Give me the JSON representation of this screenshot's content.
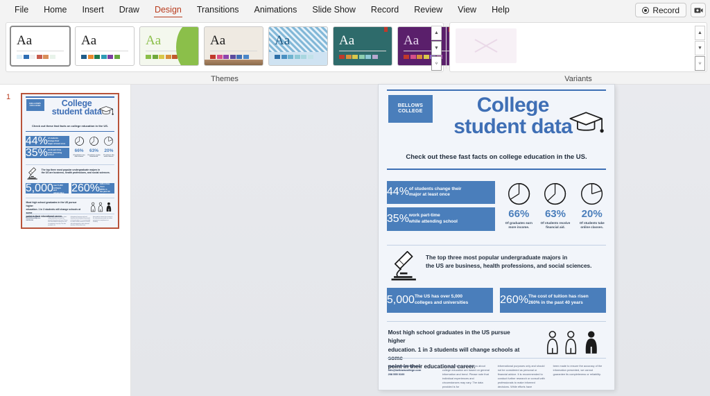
{
  "app": {
    "ribbon_tabs": [
      {
        "label": "File",
        "active": false
      },
      {
        "label": "Home",
        "active": false
      },
      {
        "label": "Insert",
        "active": false
      },
      {
        "label": "Draw",
        "active": false
      },
      {
        "label": "Design",
        "active": true
      },
      {
        "label": "Transitions",
        "active": false
      },
      {
        "label": "Animations",
        "active": false
      },
      {
        "label": "Slide Show",
        "active": false
      },
      {
        "label": "Record",
        "active": false
      },
      {
        "label": "Review",
        "active": false
      },
      {
        "label": "View",
        "active": false
      },
      {
        "label": "Help",
        "active": false
      }
    ],
    "record_button": "Record",
    "camera_icon": "camera-icon"
  },
  "ribbon": {
    "themes": {
      "group_label": "Themes",
      "tiles": [
        {
          "name": "office-theme",
          "aa": "Aa",
          "selected": true,
          "bg": "#ffffff",
          "aa_color": "#1b1b1b",
          "swatches": [
            "#dff0f7",
            "#2f6fb5",
            "#f0f0f0",
            "#c75c4e",
            "#d98f5a",
            "#e8f3ea"
          ]
        },
        {
          "name": "berlin-theme",
          "aa": "Aa",
          "selected": false,
          "bg": "#ffffff",
          "aa_color": "#1b1b1b",
          "swatches": [
            "#1f5c88",
            "#e8872b",
            "#1f7a4d",
            "#2e9bb5",
            "#7d3fa0",
            "#6aa840"
          ]
        },
        {
          "name": "celestial-theme",
          "aa": "Aa",
          "selected": false,
          "bg": "#f4f8ee",
          "aa_color": "#8bbf4a",
          "swatches": [
            "#8bbf4a",
            "#6fa83c",
            "#d9c84a",
            "#d98f3a",
            "#c05a2e",
            "#8a7f6a"
          ]
        },
        {
          "name": "damask-theme",
          "aa": "Aa",
          "selected": false,
          "bg": "#efeae2",
          "aa_color": "#1b1b1b",
          "swatches": [
            "#c0392b",
            "#d64f8a",
            "#8e44ad",
            "#5b4b9e",
            "#3f6fb5",
            "#4a86c8"
          ]
        },
        {
          "name": "parcel-theme",
          "aa": "Aa",
          "selected": false,
          "bg": "#cfe3f2",
          "aa_color": "#1f5c88",
          "swatches": [
            "#2e6fa8",
            "#4a90c2",
            "#6fb4cf",
            "#8ec9d6",
            "#a8d6df",
            "#c2e2e8"
          ]
        },
        {
          "name": "quotable-theme",
          "aa": "Aa",
          "selected": false,
          "bg": "#2e6b6b",
          "aa_color": "#ffffff",
          "swatches": [
            "#c0392b",
            "#d98f3a",
            "#d9c84a",
            "#8ecfb0",
            "#8ec9d6",
            "#b8a8cf"
          ]
        },
        {
          "name": "savon-theme",
          "aa": "Aa",
          "selected": false,
          "bg": "#5a1f6b",
          "aa_color": "#e8d6f0",
          "swatches": [
            "#c0392b",
            "#d64f8a",
            "#d98f3a",
            "#d9c84a",
            "#8a5fc0",
            "#b85fc0"
          ]
        }
      ],
      "scroll_up": "chevron-up-icon",
      "scroll_down": "chevron-down-icon",
      "more": "more-themes-icon"
    },
    "variants": {
      "group_label": "Variants",
      "tiles": [
        {
          "name": "variant-1"
        }
      ],
      "scroll_up": "chevron-up-icon",
      "scroll_down": "chevron-down-icon",
      "more": "more-variants-icon"
    }
  },
  "thumbnails": {
    "slides": [
      {
        "number": "1",
        "selected": true
      }
    ]
  },
  "slide": {
    "logo": {
      "line1": "BELLOWS",
      "line2": "COLLEGE"
    },
    "title_line1": "College",
    "title_line2": "student data",
    "subtitle": "Check out these fast facts on college education in the US.",
    "graduation_cap_icon": "graduation-cap-icon",
    "stat_bars": [
      {
        "number": "44%",
        "text_line1": "of students change their",
        "text_line2": "major at least once"
      },
      {
        "number": "35%",
        "text_line1": "work part-time",
        "text_line2": "while attending school"
      }
    ],
    "donuts": [
      {
        "percent": "66%",
        "value": 66,
        "caption_line1": "Of graduates earn",
        "caption_line2": "more income."
      },
      {
        "percent": "63%",
        "value": 63,
        "caption_line1": "Of students receive",
        "caption_line2": "financial aid."
      },
      {
        "percent": "20%",
        "value": 20,
        "caption_line1": "Of students take",
        "caption_line2": "online classes."
      }
    ],
    "microscope_icon": "microscope-icon",
    "microscope_text_line1": "The top three most popular undergraduate majors in",
    "microscope_text_line2": "the US are business, health professions, and social sciences.",
    "wide_bars": [
      {
        "number": "5,000",
        "text_line1": "The US has over 5,000",
        "text_line2": "colleges and universities"
      },
      {
        "number": "260%",
        "text_line1": "The cost of tuition has risen",
        "text_line2": "260% in the past 40 years"
      }
    ],
    "bottom_text_line1": "Most high school graduates in the US pursue higher",
    "bottom_text_line2": "education. 1 in 3 students will change schools at some",
    "bottom_text_line3": "point in their educational career.",
    "people_icon": "people-group-icon",
    "footer": [
      "www.bellowscollege.com\ninfo@bellowscollege.com\n208 555 0100",
      "The above facts and statistics about college education are based on general information and trend. Please note that individual experiences and circumstances may vary. The data provided is for",
      "informational purposes only and should not be considered as personal or financial advice. It is recommended to conduct further research or consult with professionals to make informed decisions. While efforts have",
      "been made to ensure the accuracy of the information presented, we cannot guarantee its completeness or reliability."
    ],
    "colors": {
      "brand_blue": "#4a7ebb",
      "title_blue": "#3f6fb5",
      "bg": "#f2f5fa"
    }
  }
}
